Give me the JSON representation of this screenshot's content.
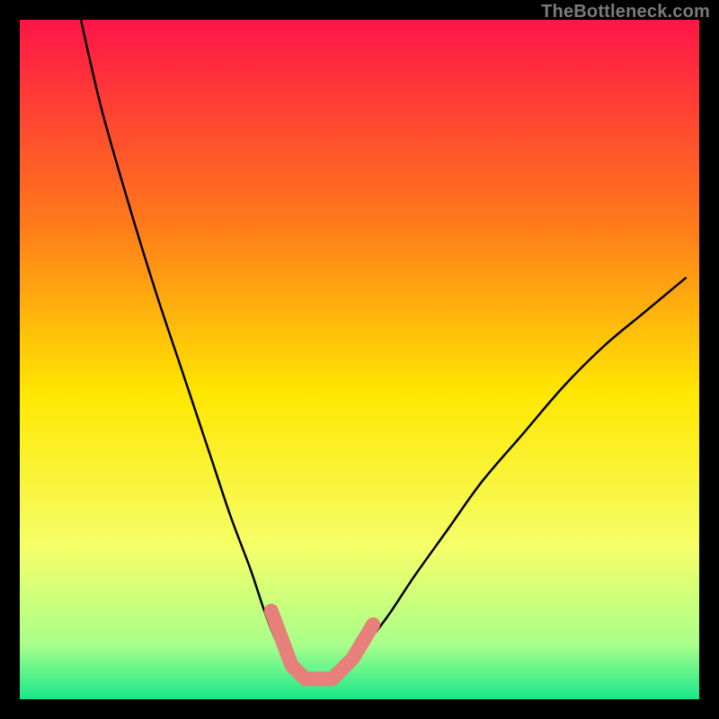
{
  "watermark": "TheBottleneck.com",
  "colors": {
    "frame": "#000000",
    "gradient_top": "#ff1547",
    "gradient_upper_mid": "#ff7a1a",
    "gradient_mid": "#ffe700",
    "gradient_lower_mid": "#f4ff6a",
    "gradient_near_bottom": "#a8ff8a",
    "gradient_bottom": "#17e88b",
    "curve": "#000000",
    "marker": "#e77f7a"
  },
  "chart_data": {
    "type": "line",
    "title": "",
    "xlabel": "",
    "ylabel": "",
    "xlim": [
      0,
      100
    ],
    "ylim": [
      0,
      100
    ],
    "series": [
      {
        "name": "bottleneck-curve",
        "x": [
          9,
          12,
          16,
          20,
          24,
          28,
          31,
          34,
          36,
          38,
          40,
          42,
          44,
          47,
          50,
          54,
          58,
          63,
          68,
          74,
          80,
          86,
          92,
          98
        ],
        "y": [
          100,
          87,
          73,
          60,
          48,
          36,
          27,
          19,
          13,
          8,
          5,
          3,
          3,
          4,
          7,
          12,
          18,
          25,
          32,
          39,
          46,
          52,
          57,
          62
        ]
      }
    ],
    "annotations": [
      {
        "name": "optimal-range-marker",
        "shape": "v-bracket",
        "points_xy": [
          [
            37,
            13
          ],
          [
            40,
            5
          ],
          [
            42,
            3
          ],
          [
            46,
            3
          ],
          [
            49,
            6
          ],
          [
            52,
            11
          ]
        ]
      }
    ]
  }
}
